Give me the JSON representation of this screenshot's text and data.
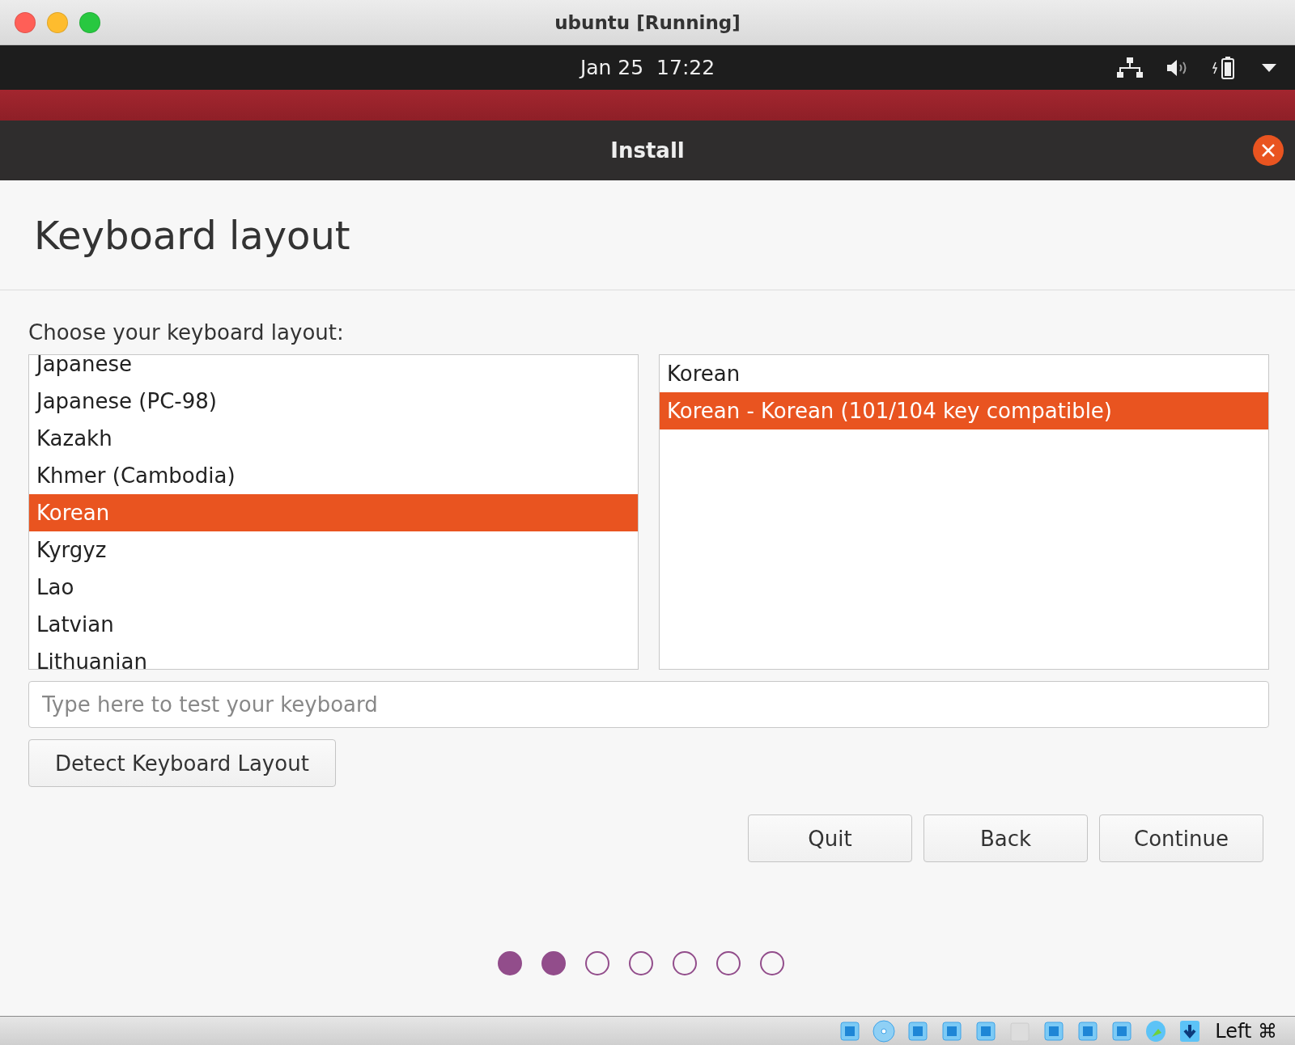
{
  "host_window": {
    "title": "ubuntu [Running]"
  },
  "top_panel": {
    "clock": "Jan 25  17:22"
  },
  "installer": {
    "title": "Install",
    "heading": "Keyboard layout",
    "prompt": "Choose your keyboard layout:",
    "layouts": [
      {
        "label": "Japanese",
        "selected": false
      },
      {
        "label": "Japanese (PC-98)",
        "selected": false
      },
      {
        "label": "Kazakh",
        "selected": false
      },
      {
        "label": "Khmer (Cambodia)",
        "selected": false
      },
      {
        "label": "Korean",
        "selected": true
      },
      {
        "label": "Kyrgyz",
        "selected": false
      },
      {
        "label": "Lao",
        "selected": false
      },
      {
        "label": "Latvian",
        "selected": false
      },
      {
        "label": "Lithuanian",
        "selected": false
      }
    ],
    "variants": [
      {
        "label": "Korean",
        "selected": false
      },
      {
        "label": "Korean - Korean (101/104 key compatible)",
        "selected": true
      }
    ],
    "test_field": {
      "placeholder": "Type here to test your keyboard"
    },
    "detect_button": "Detect Keyboard Layout",
    "buttons": [
      "Quit",
      "Back",
      "Continue"
    ],
    "steps": [
      {
        "done": true
      },
      {
        "done": true
      },
      {
        "done": false
      },
      {
        "done": false
      },
      {
        "done": false
      },
      {
        "done": false
      },
      {
        "done": false
      }
    ]
  },
  "status_bar": {
    "host_key": "Left ⌘"
  }
}
